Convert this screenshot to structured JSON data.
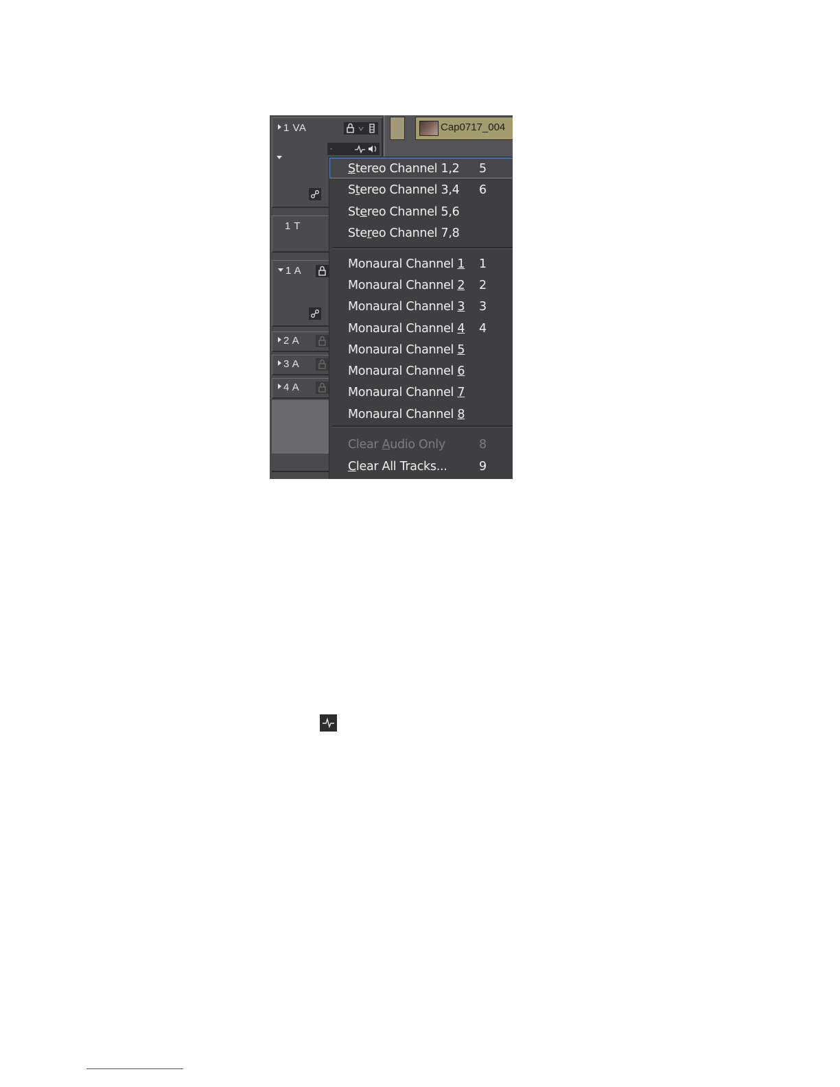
{
  "tracks": [
    {
      "label": "1 VA",
      "expanded": false
    },
    {
      "label": "1 T",
      "expanded": false
    },
    {
      "label": "1 A",
      "expanded": true
    },
    {
      "label": "2 A",
      "expanded": false
    },
    {
      "label": "3 A",
      "expanded": false
    },
    {
      "label": "4 A",
      "expanded": false
    }
  ],
  "timeline": {
    "clip_name": "Cap0717_004"
  },
  "menu": {
    "stereo": [
      {
        "pre": "",
        "u": "S",
        "post": "tereo Channel 1,2",
        "key": "5",
        "selected": true
      },
      {
        "pre": "S",
        "u": "t",
        "post": "ereo Channel 3,4",
        "key": "6"
      },
      {
        "pre": "St",
        "u": "e",
        "post": "reo Channel 5,6",
        "key": ""
      },
      {
        "pre": "Ste",
        "u": "r",
        "post": "eo Channel 7,8",
        "key": ""
      }
    ],
    "mono": [
      {
        "pre": "Monaural Channel ",
        "u": "1",
        "post": "",
        "key": "1"
      },
      {
        "pre": "Monaural Channel ",
        "u": "2",
        "post": "",
        "key": "2"
      },
      {
        "pre": "Monaural Channel ",
        "u": "3",
        "post": "",
        "key": "3"
      },
      {
        "pre": "Monaural Channel ",
        "u": "4",
        "post": "",
        "key": "4"
      },
      {
        "pre": "Monaural Channel ",
        "u": "5",
        "post": "",
        "key": ""
      },
      {
        "pre": "Monaural Channel ",
        "u": "6",
        "post": "",
        "key": ""
      },
      {
        "pre": "Monaural Channel ",
        "u": "7",
        "post": "",
        "key": ""
      },
      {
        "pre": "Monaural Channel ",
        "u": "8",
        "post": "",
        "key": ""
      }
    ],
    "clear": [
      {
        "pre": "Clear ",
        "u": "A",
        "post": "udio Only",
        "key": "8",
        "disabled": true
      },
      {
        "pre": "",
        "u": "C",
        "post": "lear All Tracks...",
        "key": "9"
      }
    ]
  },
  "colors": {
    "selection_outline": "#5b88c9",
    "clip_fill": "#a39c6e",
    "menu_bg": "#3f3f41"
  },
  "icons": {
    "lock": "lock-icon",
    "waveform": "audio-waveform-icon",
    "speaker": "speaker-icon",
    "link": "link-icon"
  }
}
